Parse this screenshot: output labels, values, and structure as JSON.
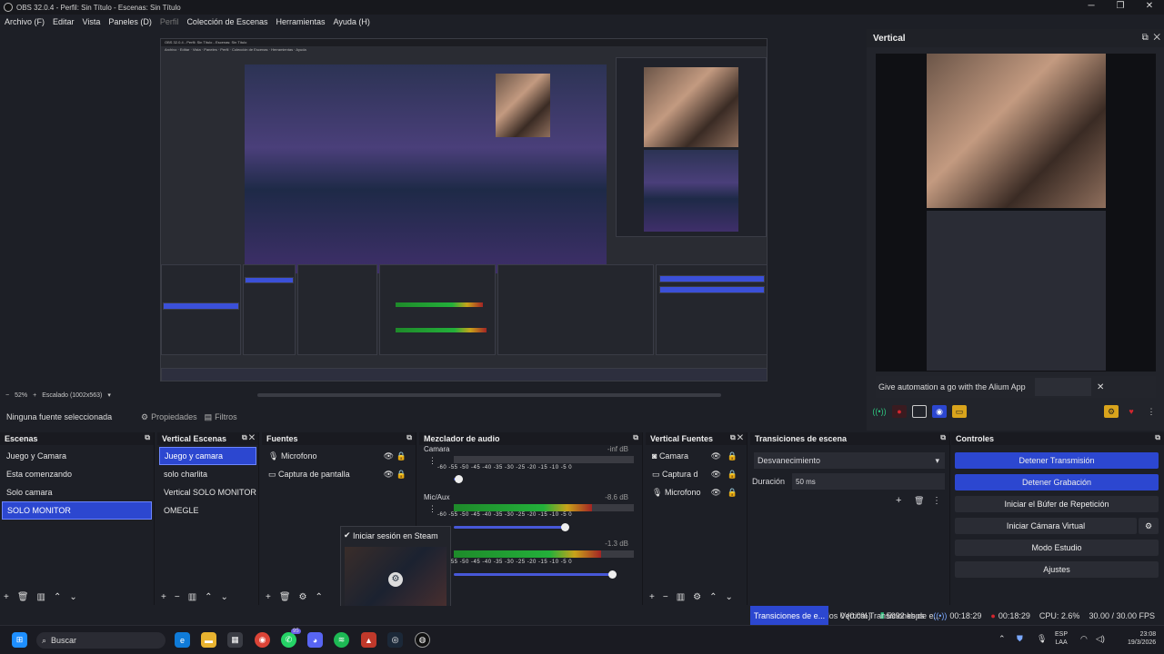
{
  "window": {
    "title": "OBS 32.0.4 - Perfil: Sin Título - Escenas: Sin Título",
    "min": "─",
    "max": "❐",
    "close": "✕"
  },
  "menu": [
    "Archivo (F)",
    "Editar",
    "Vista",
    "Paneles (D)",
    "Perfil",
    "Colección de Escenas",
    "Herramientas",
    "Ayuda (H)"
  ],
  "preview_bar": {
    "zoom": "52%",
    "scale": "Escalado (1002x563)"
  },
  "vertical": {
    "title": "Vertical",
    "alum_text": "Give automation a go with the Alium App",
    "close": "✕"
  },
  "property_bar": {
    "no_source": "Ninguna fuente seleccionada",
    "properties": "Propiedades",
    "filters": "Filtros"
  },
  "scenes": {
    "title": "Escenas",
    "items": [
      "Juego y Camara",
      "Esta comenzando",
      "Solo camara",
      "SOLO MONITOR"
    ],
    "selected": 3
  },
  "vertical_scenes": {
    "title": "Vertical Escenas",
    "items": [
      "Juego y camara",
      "solo charlita",
      "Vertical SOLO MONITOR",
      "OMEGLE"
    ],
    "selected": 0
  },
  "sources": {
    "title": "Fuentes",
    "items": [
      "Microfono",
      "Captura de pantalla"
    ]
  },
  "steam_popup": {
    "label": "Iniciar sesión en Steam"
  },
  "mixer": {
    "title": "Mezclador de audio",
    "channels": [
      {
        "name": "Camara",
        "db": "-inf dB",
        "level": 0.0,
        "volume": 0.03
      },
      {
        "name": "Mic/Aux",
        "db": "-8.6 dB",
        "level": 0.77,
        "volume": 0.7
      },
      {
        "name": "",
        "db": "-1.3 dB",
        "level": 0.82,
        "volume": 1.0
      }
    ],
    "ticks": "-60 -55 -50 -45 -40 -35 -30 -25 -20 -15 -10 -5 0"
  },
  "vertical_sources": {
    "title": "Vertical Fuentes",
    "items": [
      "Camara",
      "Captura d",
      "Microfono"
    ]
  },
  "transitions": {
    "title": "Transiciones de escena",
    "transition": "Desvanecimiento",
    "duration_label": "Duración",
    "duration_value": "50 ms"
  },
  "controls": {
    "title": "Controles",
    "buttons": [
      "Detener Transmisión",
      "Detener Grabación",
      "Iniciar el Búfer de Repetición",
      "Iniciar Cámara Virtual",
      "Modo Estudio",
      "Ajustes"
    ]
  },
  "status": {
    "tab1": "Transiciones de e...",
    "tab2": "Vertical Transiciones de e...",
    "dropped": "Fotogramas Perdidos 0 (0.0%)",
    "kbps": "5992 kbps",
    "stream_time": "00:18:29",
    "rec_time": "00:18:29",
    "cpu": "CPU: 2.6%",
    "fps": "30.00 / 30.00 FPS"
  },
  "taskbar": {
    "search": "Buscar",
    "lang1": "ESP",
    "lang2": "LAA",
    "time": "23:08",
    "date": "19/3/2026",
    "badge": "95"
  },
  "colors": {
    "accent": "#2c47d0",
    "background": "#1d1f26",
    "record": "#d3262e"
  }
}
